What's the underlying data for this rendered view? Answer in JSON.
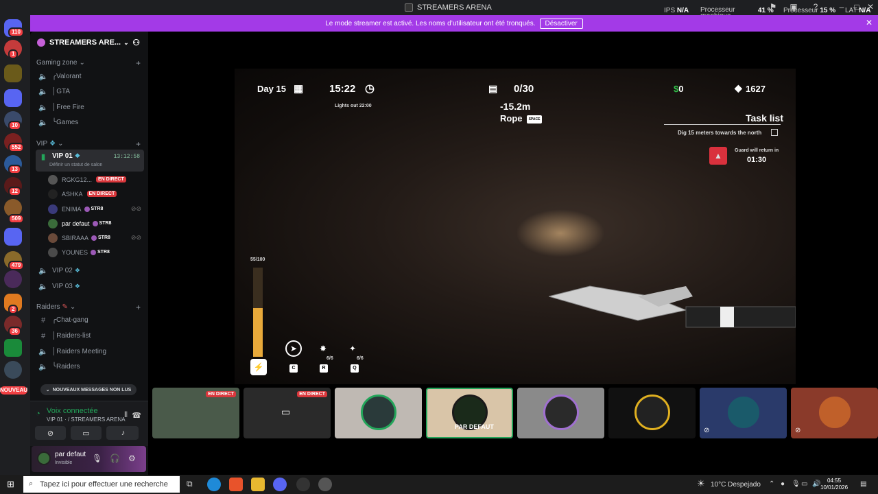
{
  "window": {
    "title": "STREAMERS ARENA"
  },
  "overlay": {
    "ips_label": "IPS",
    "ips_value": "N/A",
    "gpu_label_1": "Processeur",
    "gpu_label_2": "graphique",
    "gpu_value": "41 %",
    "cpu_label": "Processeur",
    "cpu_value": "15 %",
    "lat_label": "LAT",
    "lat_value": "N/A"
  },
  "banner": {
    "text": "Le mode streamer est activé. Les noms d’utilisateur ont été tronqués.",
    "button": "Désactiver"
  },
  "server_badges": [
    "110",
    "1",
    "10",
    "552",
    "13",
    "12",
    "509",
    "479",
    "2",
    "36"
  ],
  "new_badge": "NOUVEAU",
  "server": {
    "name": "STREAMERS ARE..."
  },
  "categories": {
    "gaming": "Gaming zone",
    "vip": "VIP",
    "raiders": "Raiders"
  },
  "channels": {
    "valorant": "╭Valorant",
    "gta": "│GTA",
    "freefire": "│Free Fire",
    "games": "╰Games",
    "vip01": "VIP 01",
    "vip01_time": "13:12:58",
    "vip01_status": "Définir un statut de salon",
    "vip02": "VIP 02",
    "vip03": "VIP 03",
    "chat_gang": "╭Chat-gang",
    "raiders_list": "│Raiders-list",
    "raiders_meeting": "│Raiders Meeting",
    "raiders": "╰Raiders"
  },
  "voice_users": [
    {
      "name": "RGKG12...",
      "live": "EN DIRECT"
    },
    {
      "name": "ASHKA",
      "live": "EN DIRECT"
    },
    {
      "name": "ENIMA",
      "tag": "STR8"
    },
    {
      "name": "par defaut",
      "tag": "STR8"
    },
    {
      "name": "SBIRAAA",
      "tag": "STR8"
    },
    {
      "name": "YOUNES",
      "tag": "STR8"
    }
  ],
  "new_messages": "NOUVEAUX MESSAGES NON LUS",
  "voice_panel": {
    "title": "Voix connectée",
    "subtitle": "VIP 01 · / STREAMERS ARENA"
  },
  "user_panel": {
    "name": "par defaut",
    "status": "Invisible"
  },
  "game_hud": {
    "day": "Day 15",
    "time": "15:22",
    "lights_out": "Lights out 22:00",
    "capacity": "0/30",
    "depth": "-15.2m",
    "rope": "Rope",
    "rope_key": "SPACE",
    "money": "0",
    "money_symbol": "$",
    "gems": "1627",
    "task_title": "Task list",
    "task_item": "Dig 15 meters towards the north",
    "guard_text": "Guard will return in",
    "guard_time": "01:30",
    "stamina": "55/100",
    "stamina_fraction": 0.55,
    "item_count_1": "6/6",
    "item_count_2": "6/6",
    "key_c": "C",
    "key_r": "R",
    "key_q": "Q"
  },
  "stream_tiles": [
    {
      "live": "EN DIRECT"
    },
    {
      "live": "EN DIRECT"
    },
    {},
    {
      "label": "PAR DEFAUT"
    },
    {},
    {},
    {},
    {}
  ],
  "taskbar": {
    "search_placeholder": "Tapez ici pour effectuer une recherche",
    "weather": "10°C  Despejado",
    "time": "04:55",
    "date": "10/01/2026"
  }
}
